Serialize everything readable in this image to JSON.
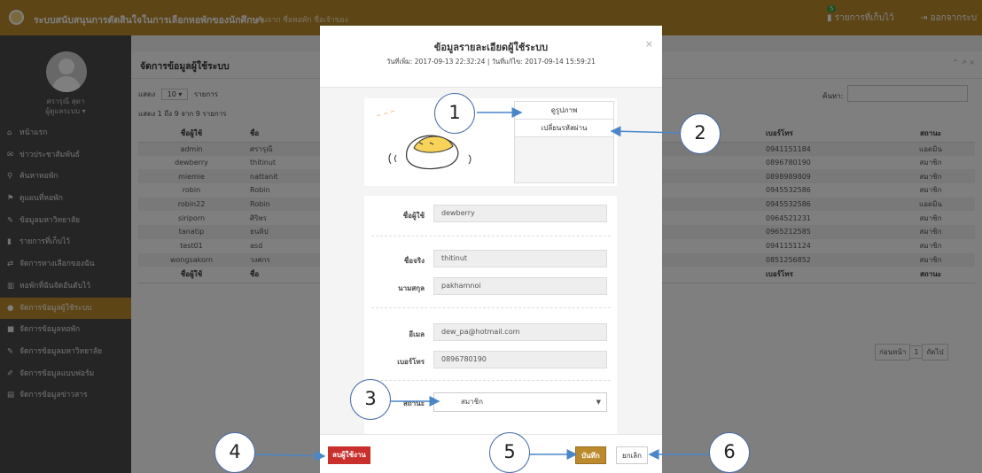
{
  "topbar": {
    "app_title": "ระบบสนับสนุนการตัดสินใจในการเลือกหอพักของนักศึกษา",
    "links": "ค้นจาก ชื่อหอพัก ชื่อเจ้าของ",
    "favorites_count": "5",
    "favorites_label": "รายการที่เก็บไว้",
    "logout_label": "ออกจากระบ"
  },
  "sidebar": {
    "user_name": "ศรารุณี สุดา",
    "user_role": "ผู้ดูแลระบบ ▾",
    "items": [
      {
        "icon": "home-icon",
        "glyph": "⌂",
        "label": "หน้าแรก"
      },
      {
        "icon": "megaphone-icon",
        "glyph": "✉",
        "label": "ข่าวประชาสัมพันธ์"
      },
      {
        "icon": "search-icon",
        "glyph": "⚲",
        "label": "ค้นหาหอพัก"
      },
      {
        "icon": "map-marker-icon",
        "glyph": "⚑",
        "label": "ดูแผนที่หอพัก"
      },
      {
        "icon": "graduation-cap-icon",
        "glyph": "✎",
        "label": "ข้อมูลมหาวิทยาลัย"
      },
      {
        "icon": "bookmark-icon",
        "glyph": "▮",
        "label": "รายการที่เก็บไว้"
      },
      {
        "icon": "exchange-icon",
        "glyph": "⇄",
        "label": "จัดการทางเลือกของฉัน"
      },
      {
        "icon": "bar-chart-icon",
        "glyph": "▥",
        "label": "หอพักที่ฉันจัดอันดับไว้"
      },
      {
        "icon": "user-icon",
        "glyph": "●",
        "label": "จัดการข้อมูลผู้ใช้ระบบ"
      },
      {
        "icon": "building-icon",
        "glyph": "■",
        "label": "จัดการข้อมูลหอพัก"
      },
      {
        "icon": "graduation-cap-icon",
        "glyph": "✎",
        "label": "จัดการข้อมูลมหาวิทยาลัย"
      },
      {
        "icon": "form-icon",
        "glyph": "✐",
        "label": "จัดการข้อมูลแบบฟอร์ม"
      },
      {
        "icon": "newspaper-icon",
        "glyph": "▤",
        "label": "จัดการข้อมูลข่าวสาร"
      }
    ]
  },
  "panel": {
    "title": "จัดการข้อมูลผู้ใช้ระบบ",
    "tools": "^ ↗ ×",
    "show_label": "แสดง",
    "show_value": "10",
    "show_unit": "รายการ",
    "info": "แสดง 1 ถึง 9 จาก 9 รายการ",
    "search_label": "ค้นหา:",
    "columns": [
      "ชื่อผู้ใช้",
      "ชื่อ",
      "",
      "เบอร์โทร",
      "สถานะ"
    ],
    "rows": [
      [
        "admin",
        "ศรารุณี",
        "",
        "0941151184",
        "แอดมิน"
      ],
      [
        "dewberry",
        "thitinut",
        "",
        "0896780190",
        "สมาชิก"
      ],
      [
        "miemie",
        "nattanit",
        "",
        "0898989809",
        "สมาชิก"
      ],
      [
        "robin",
        "Robin",
        "",
        "0945532586",
        "สมาชิก"
      ],
      [
        "robin22",
        "Robin",
        "",
        "0945532586",
        "แอดมิน"
      ],
      [
        "siriporn",
        "ศิริพร",
        "",
        "0964521231",
        "สมาชิก"
      ],
      [
        "tanatip",
        "ธนทิป",
        "",
        "0965212585",
        "สมาชิก"
      ],
      [
        "test01",
        "asd",
        "",
        "0941151124",
        "สมาชิก"
      ],
      [
        "wongsakorn",
        "วงศกร",
        "",
        "0851256852",
        "สมาชิก"
      ]
    ],
    "footer_columns": [
      "ชื่อผู้ใช้",
      "ชื่อ",
      "",
      "เบอร์โทร",
      "สถานะ"
    ],
    "pager": {
      "prev": "ก่อนหน้า",
      "page": "1",
      "next": "ถัดไป"
    }
  },
  "modal": {
    "title": "ข้อมูลรายละเอียดผู้ใช้ระบบ",
    "subtitle": "วันที่เพิ่ม: 2017-09-13 22:32:24 | วันที่แก้ไข: 2017-09-14 15:59:21",
    "close": "×",
    "photo_button": "ดูรูปภาพ",
    "change_password_button": "เปลี่ยนรหัสผ่าน",
    "fields": {
      "username_label": "ชื่อผู้ใช้",
      "username": "dewberry",
      "firstname_label": "ชื่อจริง",
      "firstname": "thitinut",
      "lastname_label": "นามสกุล",
      "lastname": "pakhamnoi",
      "email_label": "อีเมล",
      "email": "dew_pa@hotmail.com",
      "phone_label": "เบอร์โทร",
      "phone": "0896780190",
      "status_label": "สถานะ",
      "status": "สมาชิก"
    },
    "delete_button": "ลบผู้ใช้งาน",
    "save_button": "บันทึก",
    "cancel_button": "ยกเลิก"
  },
  "callouts": [
    "1",
    "2",
    "3",
    "4",
    "5",
    "6"
  ]
}
